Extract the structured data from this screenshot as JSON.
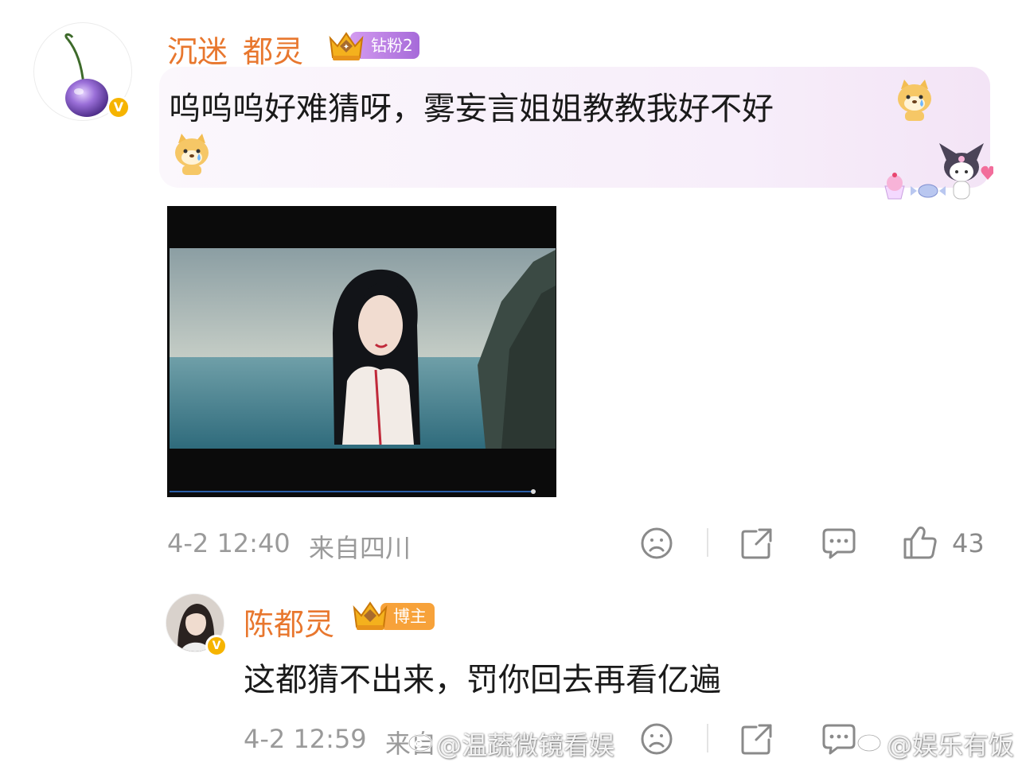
{
  "comment": {
    "username": "沉迷_都灵",
    "verified_badge": "V",
    "fan_badge": "钻粉2",
    "text_line1": "呜呜呜好难猜呀，雾妄言姐姐教教我好不好",
    "emoji": "doge-cry-emoji",
    "timestamp": "4-2 12:40",
    "location": "来自四川",
    "like_count": "43"
  },
  "reply": {
    "username": "陈都灵",
    "verified_badge": "V",
    "host_badge": "博主",
    "text": "这都猜不出来，罚你回去再看亿遍",
    "timestamp": "4-2 12:59",
    "location": "来自"
  },
  "watermarks": {
    "left": "@温蔬微镜看娱",
    "right": "@娱乐有饭"
  },
  "colors": {
    "username": "#e8772e",
    "meta_text": "#9a9a9a",
    "fan_badge": "#b57ae0",
    "host_badge": "#f7a23a",
    "verified": "#f6b400",
    "bubble_bg": "#f7eefa"
  },
  "icons": {
    "dislike": "frown-face-icon",
    "forward": "share-icon",
    "comment": "comment-icon",
    "like": "thumb-up-icon"
  }
}
